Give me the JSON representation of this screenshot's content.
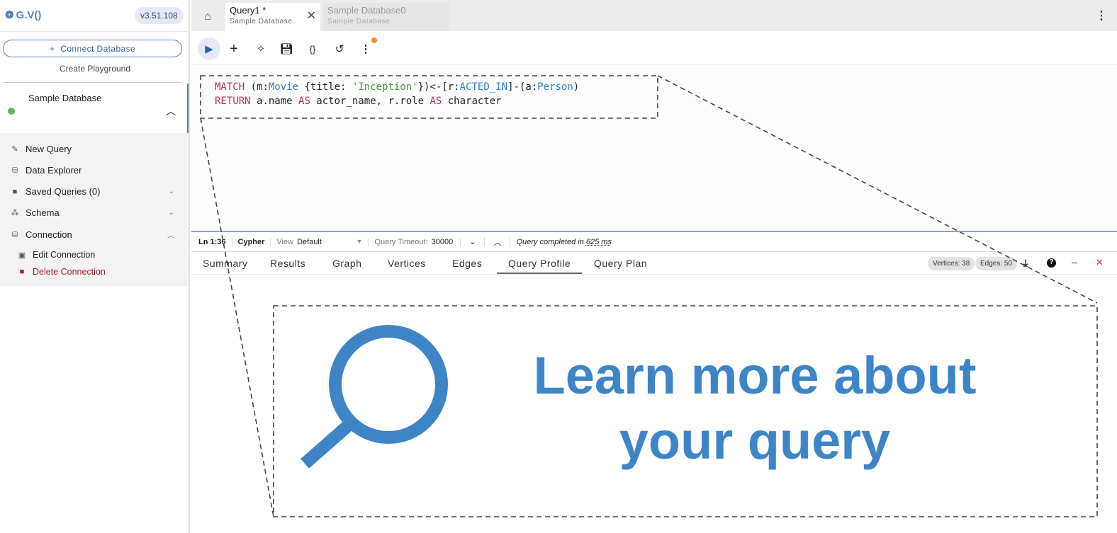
{
  "app": {
    "logo": "G.V()",
    "version": "v3.51.108"
  },
  "sidebar": {
    "connect": "Connect Database",
    "playground": "Create Playground",
    "database": "Sample Database",
    "items": [
      {
        "label": "New Query",
        "icon": "wand-icon"
      },
      {
        "label": "Data Explorer",
        "icon": "database-search-icon"
      },
      {
        "label": "Saved Queries (0)",
        "icon": "folder-icon"
      },
      {
        "label": "Schema",
        "icon": "schema-icon"
      },
      {
        "label": "Connection",
        "icon": "database-icon"
      },
      {
        "label": "Edit Connection",
        "icon": "edit-icon"
      },
      {
        "label": "Delete Connection",
        "icon": "trash-icon"
      }
    ]
  },
  "tabs": [
    {
      "title": "Query1 *",
      "sub": "Sample Database"
    },
    {
      "title": "Sample Database0",
      "sub": "Sample Database"
    }
  ],
  "editor": {
    "line1": [
      "MATCH",
      " (m:",
      "Movie",
      " {title: ",
      "'Inception'",
      "})<-[r:",
      "ACTED_IN",
      "]-(a:",
      "Person",
      ")"
    ],
    "line2": [
      "RETURN",
      " a.name ",
      "AS",
      " actor_name, r.role ",
      "AS",
      " character"
    ]
  },
  "status": {
    "pos": "Ln 1:36",
    "lang": "Cypher",
    "view_label": "View",
    "view": "Default",
    "timeout_label": "Query Timeout:",
    "timeout": "30000",
    "completed": "Query completed in",
    "time": "625 ms"
  },
  "results": {
    "tabs": [
      "Summary",
      "Results",
      "Graph",
      "Vertices",
      "Edges",
      "Query Profile",
      "Query Plan"
    ],
    "vertices": "Vertices: 38",
    "edges": "Edges: 50"
  },
  "callout": {
    "text": "Learn more about your query"
  },
  "colors": {
    "accent": "#3d85c6",
    "keyword": "#b03060",
    "label": "#2c7fc9"
  }
}
